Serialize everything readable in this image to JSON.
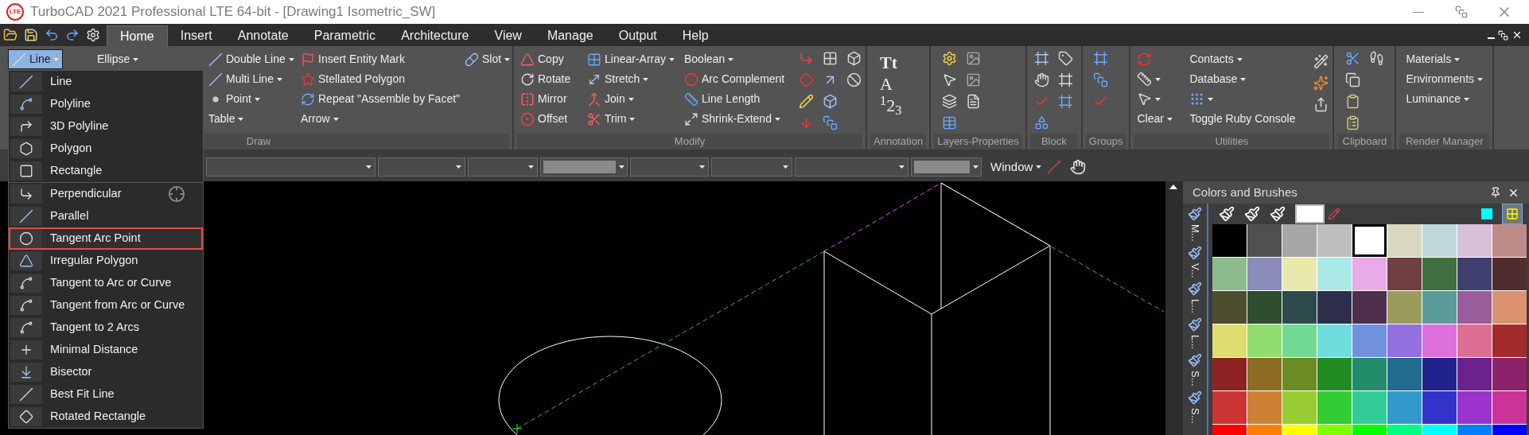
{
  "window": {
    "title": "TurboCAD 2021 Professional LTE 64-bit - [Drawing1 Isometric_SW]",
    "logo": "LTE"
  },
  "menu_tabs": [
    {
      "label": "Home",
      "selected": true
    },
    {
      "label": "Insert",
      "selected": false
    },
    {
      "label": "Annotate",
      "selected": false
    },
    {
      "label": "Parametric",
      "selected": false
    },
    {
      "label": "Architecture",
      "selected": false
    },
    {
      "label": "View",
      "selected": false
    },
    {
      "label": "Manage",
      "selected": false
    },
    {
      "label": "Output",
      "selected": false
    },
    {
      "label": "Help",
      "selected": false
    }
  ],
  "ribbon": {
    "groups": [
      {
        "kind": "draw",
        "label": "Draw",
        "columns": [
          [
            {
              "label": "Line",
              "dropdown": true,
              "pressed": true
            }
          ],
          [
            {
              "label": "Ellipse",
              "dropdown": true,
              "pressed": false
            }
          ],
          [
            {
              "label": "Double Line",
              "dropdown": true,
              "pressed": false
            },
            {
              "label": "Multi Line",
              "dropdown": true,
              "pressed": false
            },
            {
              "label": "Point",
              "dropdown": true,
              "pressed": false
            },
            {
              "label": "Table",
              "dropdown": true,
              "pressed": false
            }
          ],
          [
            {
              "label": "Insert Entity Mark",
              "dropdown": false,
              "pressed": false
            },
            {
              "label": "Stellated Polygon",
              "dropdown": false,
              "pressed": false
            },
            {
              "label": "Repeat \"Assemble by Facet\"",
              "dropdown": false,
              "pressed": false
            },
            {
              "label": "Arrow",
              "dropdown": true,
              "pressed": false
            }
          ],
          [
            {
              "label": "Slot",
              "dropdown": true,
              "pressed": false
            }
          ]
        ]
      },
      {
        "kind": "modify",
        "label": "Modify",
        "columns": [
          [
            {
              "label": "Copy",
              "dropdown": false
            },
            {
              "label": "Rotate",
              "dropdown": false
            },
            {
              "label": "Mirror",
              "dropdown": false
            },
            {
              "label": "Offset",
              "dropdown": false
            }
          ],
          [
            {
              "label": "Linear-Array",
              "dropdown": true
            },
            {
              "label": "Stretch",
              "dropdown": true
            },
            {
              "label": "Join",
              "dropdown": true
            },
            {
              "label": "Trim",
              "dropdown": true
            }
          ],
          [
            {
              "label": "Boolean",
              "dropdown": true
            },
            {
              "label": "Arc Complement",
              "dropdown": false
            },
            {
              "label": "Line Length",
              "dropdown": false
            },
            {
              "label": "Shrink-Extend",
              "dropdown": true
            }
          ]
        ]
      },
      {
        "kind": "annotation",
        "label": "Annotation",
        "glyphs": [
          "Tt",
          "A",
          "$^{1}$2$_{3}$"
        ]
      },
      {
        "kind": "layers",
        "label": "Layers-Properties"
      },
      {
        "kind": "block",
        "label": "Block"
      },
      {
        "kind": "groups",
        "label": "Groups"
      },
      {
        "kind": "utilities",
        "label": "Utilities",
        "columns": [
          [
            {
              "label": "Clear",
              "dropdown": true
            }
          ],
          [
            {
              "label": "Contacts",
              "dropdown": true
            },
            {
              "label": "Database",
              "dropdown": true
            },
            {
              "label": "Toggle Ruby Console",
              "dropdown": false
            }
          ]
        ]
      },
      {
        "kind": "clipboard",
        "label": "Clipboard"
      },
      {
        "kind": "render",
        "label": "Render Manager",
        "columns": [
          [
            {
              "label": "Materials",
              "dropdown": true
            },
            {
              "label": "Environments",
              "dropdown": true
            },
            {
              "label": "Luminance",
              "dropdown": true
            }
          ]
        ]
      }
    ]
  },
  "toolbar": {
    "fields": [
      {
        "kind": "dropdown"
      },
      {
        "kind": "dropdown"
      },
      {
        "kind": "dropdown"
      },
      {
        "kind": "swatch"
      },
      {
        "kind": "dropdown"
      },
      {
        "kind": "dropdown"
      },
      {
        "kind": "dropdown"
      },
      {
        "kind": "swatch"
      }
    ],
    "window_button": {
      "label": "Window",
      "dropdown": true
    }
  },
  "line_menu": {
    "sections": [
      {
        "items": [
          {
            "label": "Line",
            "selected": false
          },
          {
            "label": "Polyline",
            "selected": false
          },
          {
            "label": "3D Polyline",
            "selected": false
          },
          {
            "label": "Polygon",
            "selected": false
          },
          {
            "label": "Rectangle",
            "selected": false
          }
        ]
      },
      {
        "items": [
          {
            "label": "Perpendicular",
            "selected": false
          },
          {
            "label": "Parallel",
            "selected": false
          },
          {
            "label": "Tangent Arc Point",
            "selected": true
          },
          {
            "label": "Irregular Polygon",
            "selected": false
          },
          {
            "label": "Tangent to Arc or Curve",
            "selected": false
          },
          {
            "label": "Tangent from Arc or Curve",
            "selected": false
          },
          {
            "label": "Tangent to 2 Arcs",
            "selected": false
          },
          {
            "label": "Minimal Distance",
            "selected": false
          },
          {
            "label": "Bisector",
            "selected": false
          },
          {
            "label": "Best Fit Line",
            "selected": false
          },
          {
            "label": "Rotated Rectangle",
            "selected": false
          }
        ]
      }
    ]
  },
  "panel": {
    "title": "Colors and Brushes",
    "side_tabs": [
      "M...",
      "V...",
      "L...",
      "L...",
      "S...",
      "S..."
    ],
    "swatches": [
      {
        "color": "#000000",
        "selected": false
      },
      {
        "color": "#505050",
        "selected": false
      },
      {
        "color": "#a6a6a6",
        "selected": false
      },
      {
        "color": "#bebebe",
        "selected": false
      },
      {
        "color": "#ffffff",
        "selected": true
      },
      {
        "color": "#d8d8c0",
        "selected": false
      },
      {
        "color": "#c0d8d8",
        "selected": false
      },
      {
        "color": "#d8c0d8",
        "selected": false
      },
      {
        "color": "#bd8a88",
        "selected": false
      },
      {
        "color": "#8cbb8c",
        "selected": false
      },
      {
        "color": "#8c8cbb",
        "selected": false
      },
      {
        "color": "#e8e8aa",
        "selected": false
      },
      {
        "color": "#aae8e8",
        "selected": false
      },
      {
        "color": "#e8aae8",
        "selected": false
      },
      {
        "color": "#703f40",
        "selected": false
      },
      {
        "color": "#3f703f",
        "selected": false
      },
      {
        "color": "#3f3f70",
        "selected": false
      },
      {
        "color": "#4f2d2d",
        "selected": false
      },
      {
        "color": "#4d4d30",
        "selected": false
      },
      {
        "color": "#2e4d2e",
        "selected": false
      },
      {
        "color": "#2e4a4d",
        "selected": false
      },
      {
        "color": "#2e2e4d",
        "selected": false
      },
      {
        "color": "#4d2e4d",
        "selected": false
      },
      {
        "color": "#9b9b5c",
        "selected": false
      },
      {
        "color": "#5c9b9b",
        "selected": false
      },
      {
        "color": "#9b5c9b",
        "selected": false
      },
      {
        "color": "#db9270",
        "selected": false
      },
      {
        "color": "#dddd70",
        "selected": false
      },
      {
        "color": "#92dd70",
        "selected": false
      },
      {
        "color": "#70d992",
        "selected": false
      },
      {
        "color": "#70dddd",
        "selected": false
      },
      {
        "color": "#7092dd",
        "selected": false
      },
      {
        "color": "#9270dd",
        "selected": false
      },
      {
        "color": "#dd70dd",
        "selected": false
      },
      {
        "color": "#dd7092",
        "selected": false
      },
      {
        "color": "#a32b2b",
        "selected": false
      },
      {
        "color": "#8c2222",
        "selected": false
      },
      {
        "color": "#8c6b22",
        "selected": false
      },
      {
        "color": "#6b8c22",
        "selected": false
      },
      {
        "color": "#228c22",
        "selected": false
      },
      {
        "color": "#228c6b",
        "selected": false
      },
      {
        "color": "#226b8c",
        "selected": false
      },
      {
        "color": "#22228c",
        "selected": false
      },
      {
        "color": "#6b228c",
        "selected": false
      },
      {
        "color": "#8c226b",
        "selected": false
      },
      {
        "color": "#cc3333",
        "selected": false
      },
      {
        "color": "#cc8033",
        "selected": false
      },
      {
        "color": "#99cc33",
        "selected": false
      },
      {
        "color": "#33cc33",
        "selected": false
      },
      {
        "color": "#33cc99",
        "selected": false
      },
      {
        "color": "#3399cc",
        "selected": false
      },
      {
        "color": "#3333cc",
        "selected": false
      },
      {
        "color": "#9933cc",
        "selected": false
      },
      {
        "color": "#cc3399",
        "selected": false
      },
      {
        "color": "#ff0000",
        "selected": false
      },
      {
        "color": "#ff8000",
        "selected": false
      },
      {
        "color": "#ffff00",
        "selected": false
      },
      {
        "color": "#80ff00",
        "selected": false
      },
      {
        "color": "#00ff00",
        "selected": false
      },
      {
        "color": "#00ff80",
        "selected": false
      },
      {
        "color": "#00ffff",
        "selected": false
      },
      {
        "color": "#0080ff",
        "selected": false
      },
      {
        "color": "#0000ff",
        "selected": false
      }
    ]
  }
}
